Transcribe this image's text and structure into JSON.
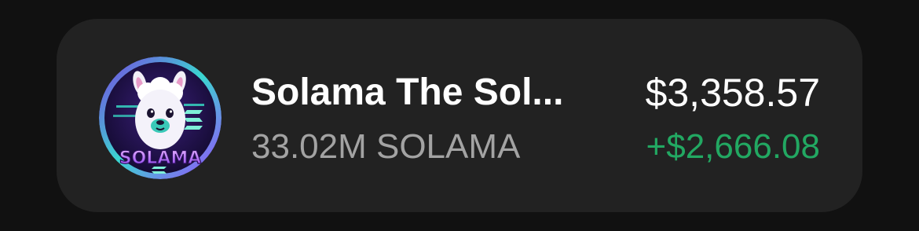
{
  "asset": {
    "name": "Solama The Sol...",
    "balance": "33.02M SOLAMA",
    "fiat_value": "$3,358.57",
    "change": "+$2,666.08",
    "logo_text": "SOLAMA",
    "logo_icon": "llama-logo-icon",
    "colors": {
      "change_positive": "#22a862",
      "card_background": "#222222",
      "page_background": "#111111"
    }
  }
}
